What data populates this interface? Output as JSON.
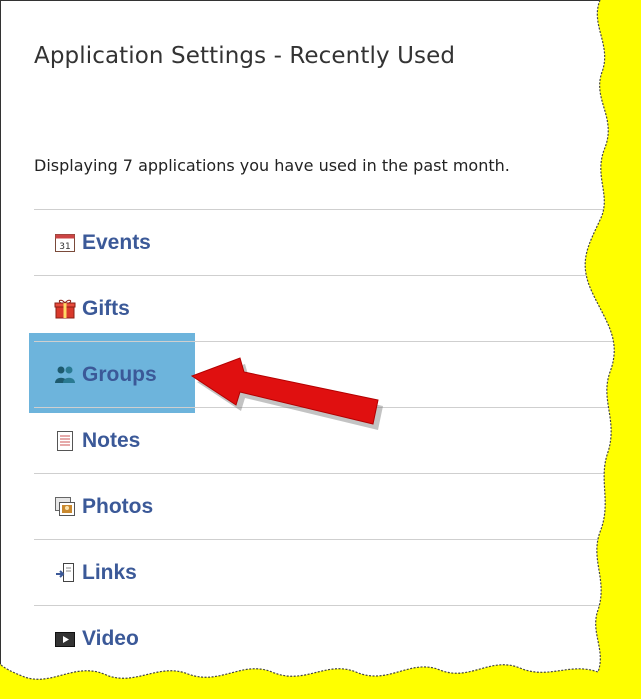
{
  "header": {
    "title": "Application Settings - Recently Used",
    "subtitle": "Displaying 7 applications you have used in the past month."
  },
  "apps": [
    {
      "label": "Events",
      "icon": "calendar-icon",
      "icon_text": "31"
    },
    {
      "label": "Gifts",
      "icon": "gift-icon"
    },
    {
      "label": "Groups",
      "icon": "groups-icon",
      "highlighted": true
    },
    {
      "label": "Notes",
      "icon": "notes-icon"
    },
    {
      "label": "Photos",
      "icon": "photos-icon"
    },
    {
      "label": "Links",
      "icon": "links-icon"
    },
    {
      "label": "Video",
      "icon": "video-icon",
      "partially_hidden": true
    }
  ],
  "colors": {
    "link": "#3b5998",
    "highlight": "#6db4dc",
    "background": "#ffff00",
    "arrow": "#e01010"
  }
}
